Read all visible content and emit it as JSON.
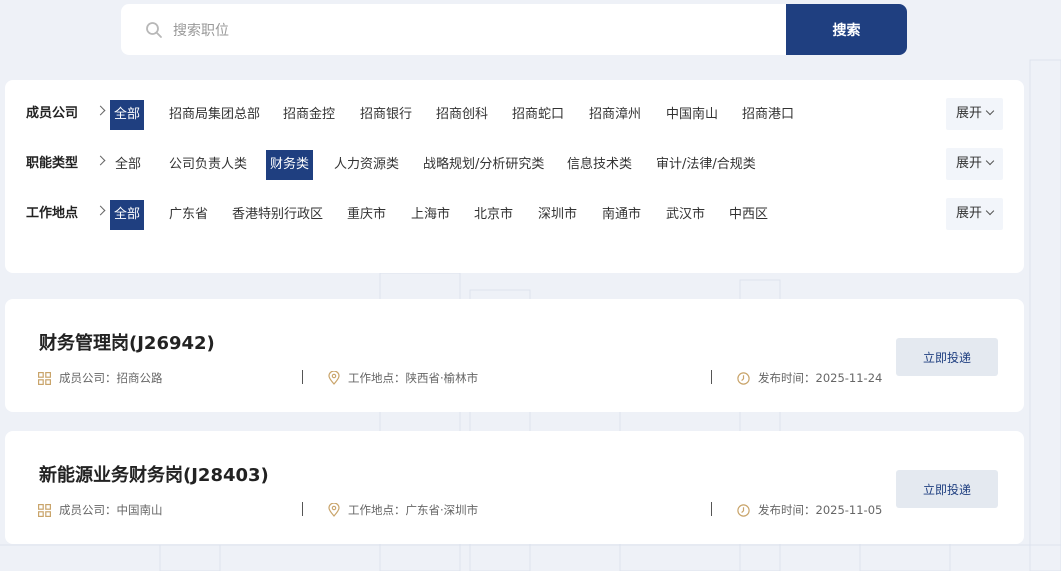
{
  "search": {
    "placeholder": "搜索职位",
    "button_label": "搜索"
  },
  "filters": {
    "expand_label": "展开",
    "rows": [
      {
        "label": "成员公司",
        "options": [
          "全部",
          "招商局集团总部",
          "招商金控",
          "招商银行",
          "招商创科",
          "招商蛇口",
          "招商漳州",
          "中国南山",
          "招商港口"
        ],
        "selected": "全部"
      },
      {
        "label": "职能类型",
        "options": [
          "全部",
          "公司负责人类",
          "财务类",
          "人力资源类",
          "战略规划/分析研究类",
          "信息技术类",
          "审计/法律/合规类"
        ],
        "selected": "财务类"
      },
      {
        "label": "工作地点",
        "options": [
          "全部",
          "广东省",
          "香港特别行政区",
          "重庆市",
          "上海市",
          "北京市",
          "深圳市",
          "南通市",
          "武汉市",
          "中西区"
        ],
        "selected": "全部"
      }
    ]
  },
  "jobs": [
    {
      "title": "财务管理岗(J26942)",
      "company": "成员公司：招商公路",
      "location": "工作地点：陕西省·榆林市",
      "date": "发布时间：2025-11-24",
      "apply_label": "立即投递"
    },
    {
      "title": "新能源业务财务岗(J28403)",
      "company": "成员公司：中国南山",
      "location": "工作地点：广东省·深圳市",
      "date": "发布时间：2025-11-05",
      "apply_label": "立即投递"
    }
  ],
  "colors": {
    "primary": "#1f3f80",
    "background": "#eef1f7",
    "icon_gold": "#c9a46a"
  }
}
